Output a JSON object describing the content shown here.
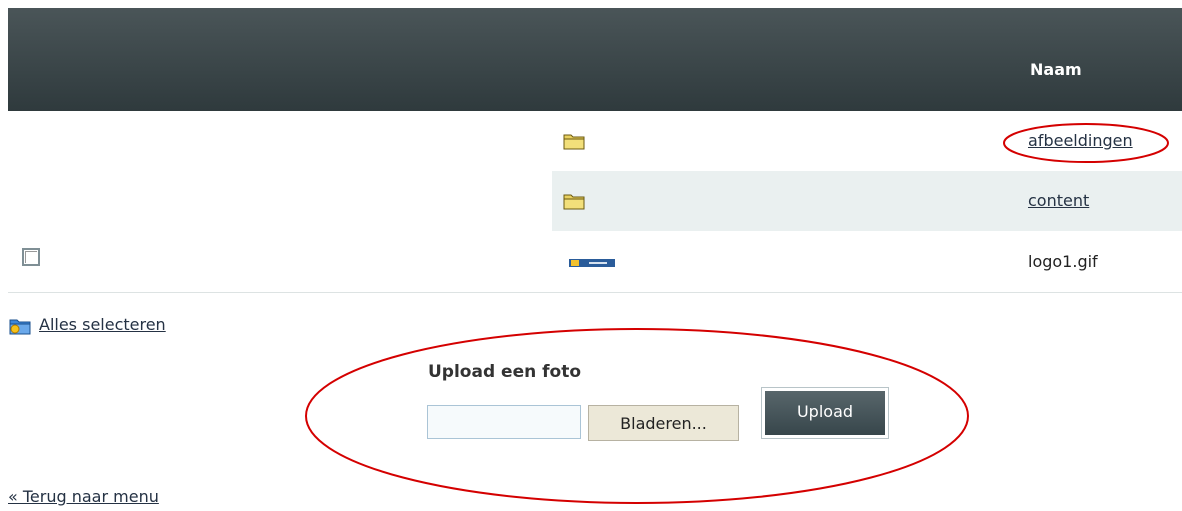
{
  "table": {
    "column_header": "Naam",
    "rows": [
      {
        "type": "folder",
        "icon": "folder-icon",
        "name": "afbeeldingen",
        "link": true
      },
      {
        "type": "folder",
        "icon": "folder-icon",
        "name": "content",
        "link": true
      },
      {
        "type": "file",
        "icon": "image-thumbnail",
        "name": "logo1.gif",
        "link": false,
        "checkbox": true
      }
    ]
  },
  "select_all": {
    "label": "Alles selecteren",
    "icon": "select-all-folder-icon"
  },
  "upload": {
    "title": "Upload een foto",
    "browse_label": "Bladeren...",
    "submit_label": "Upload"
  },
  "back_link": "« Terug naar menu",
  "colors": {
    "header_bg": "#2f3a3d",
    "row_alt_bg": "#eaf0f0",
    "link": "#253244",
    "annotation": "#d40000"
  }
}
